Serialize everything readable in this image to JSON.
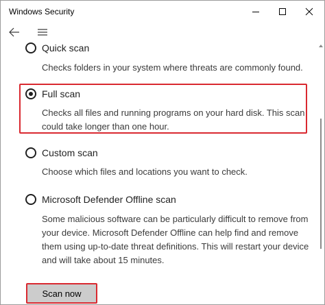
{
  "window": {
    "title": "Windows Security"
  },
  "nav": {
    "back_icon": "back-arrow-icon",
    "menu_icon": "hamburger-menu-icon"
  },
  "scan_options": [
    {
      "label": "Quick scan",
      "description": "Checks folders in your system where threats are commonly found.",
      "selected": false
    },
    {
      "label": "Full scan",
      "description": "Checks all files and running programs on your hard disk. This scan could take longer than one hour.",
      "selected": true
    },
    {
      "label": "Custom scan",
      "description": "Choose which files and locations you want to check.",
      "selected": false
    },
    {
      "label": "Microsoft Defender Offline scan",
      "description": "Some malicious software can be particularly difficult to remove from your device. Microsoft Defender Offline can help find and remove them using up-to-date threat definitions. This will restart your device and will take about 15 minutes.",
      "selected": false
    }
  ],
  "actions": {
    "scan_now_label": "Scan now"
  },
  "colors": {
    "highlight": "#d9282f",
    "button_bg": "#cccccc",
    "text": "#1f1f1f"
  }
}
